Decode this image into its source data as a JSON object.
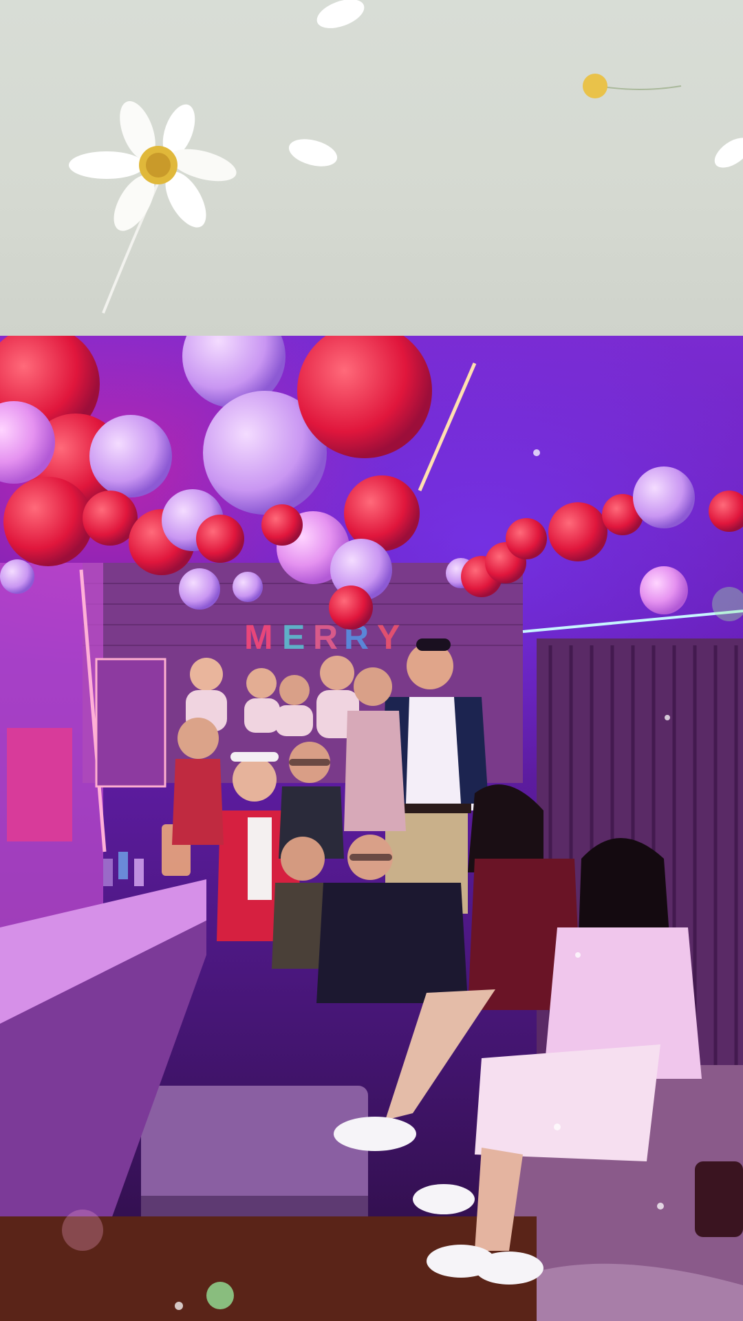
{
  "scene": {
    "top_banner": {
      "description_icon": "daisy-flower-icon"
    },
    "photo": {
      "balloon_letters_visible": "MERRY"
    }
  }
}
